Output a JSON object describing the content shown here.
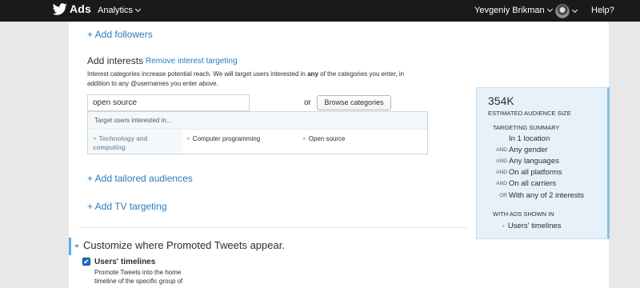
{
  "topbar": {
    "brand": "Ads",
    "nav_analytics": "Analytics",
    "user_name": "Yevgeniy Brikman",
    "help": "Help?"
  },
  "links": {
    "add_followers": "+ Add followers",
    "add_tailored": "+ Add tailored audiences",
    "add_tv": "+ Add TV targeting"
  },
  "interests": {
    "heading": "Add interests",
    "remove_link": "Remove interest targeting",
    "description_pre": "Interest categories increase potential reach. We will target users interested in ",
    "description_bold": "any",
    "description_post": " of the categories you enter, in addition to any @usernames you enter above.",
    "search_value": "open source",
    "or_label": "or",
    "browse_button": "Browse categories",
    "suggestion_header": "Target users interested in…",
    "chips": [
      "Technology and computing",
      "Computer programming",
      "Open source"
    ],
    "chip_remove_glyph": "×"
  },
  "placement": {
    "title": "Customize where Promoted Tweets appear.",
    "checkbox_label": "Users' timelines",
    "checkbox_checked": true,
    "checkbox_glyph": "✔",
    "checkbox_desc": "Promote Tweets into the home timeline of the specific group of"
  },
  "summary": {
    "audience_size": "354K",
    "audience_caption": "ESTIMATED AUDIENCE SIZE",
    "targeting_heading": "TARGETING SUMMARY",
    "rows": [
      {
        "connector": "",
        "value": "In 1 location"
      },
      {
        "connector": "AND",
        "value": "Any gender"
      },
      {
        "connector": "AND",
        "value": "Any languages"
      },
      {
        "connector": "AND",
        "value": "On all platforms"
      },
      {
        "connector": "AND",
        "value": "On all carriers"
      },
      {
        "connector": "OR",
        "value": "With any of 2 interests"
      }
    ],
    "ads_heading": "WITH ADS SHOWN IN",
    "ads_item": "Users' timelines",
    "bullet_glyph": "•"
  },
  "colors": {
    "link": "#2b7bb9",
    "topbar": "#1a1a1a",
    "summary_bg": "#e6f1f9",
    "accent": "#55acee"
  }
}
